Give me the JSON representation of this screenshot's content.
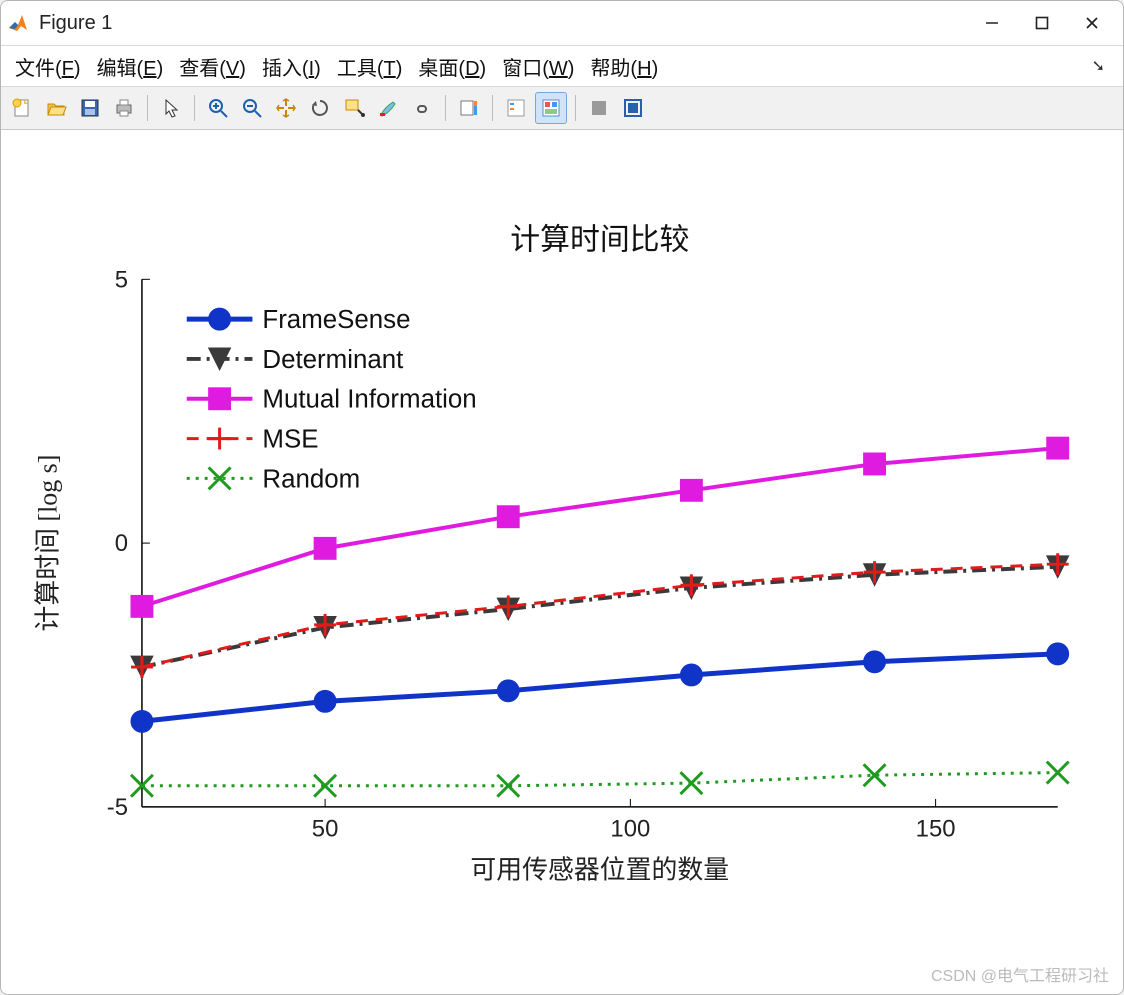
{
  "window": {
    "title": "Figure 1"
  },
  "menu": {
    "file": {
      "text": "文件(",
      "accel": "F",
      "tail": ")"
    },
    "edit": {
      "text": "编辑(",
      "accel": "E",
      "tail": ")"
    },
    "view": {
      "text": "查看(",
      "accel": "V",
      "tail": ")"
    },
    "insert": {
      "text": "插入(",
      "accel": "I",
      "tail": ")"
    },
    "tools": {
      "text": "工具(",
      "accel": "T",
      "tail": ")"
    },
    "desktop": {
      "text": "桌面(",
      "accel": "D",
      "tail": ")"
    },
    "windowm": {
      "text": "窗口(",
      "accel": "W",
      "tail": ")"
    },
    "help": {
      "text": "帮助(",
      "accel": "H",
      "tail": ")"
    }
  },
  "watermark": "CSDN @电气工程研习社",
  "chart_data": {
    "type": "line",
    "title": "计算时间比较",
    "xlabel": "可用传感器位置的数量",
    "ylabel": "计算时间 [log s]",
    "xlim": [
      20,
      170
    ],
    "ylim": [
      -5,
      5
    ],
    "xticks": [
      50,
      100,
      150
    ],
    "yticks": [
      -5,
      0,
      5
    ],
    "x": [
      20,
      50,
      80,
      110,
      140,
      170
    ],
    "series": [
      {
        "name": "FrameSense",
        "color": "#1134c8",
        "marker": "circle",
        "dash": "solid",
        "lw": 5,
        "values": [
          -3.38,
          -3.0,
          -2.8,
          -2.5,
          -2.25,
          -2.1
        ]
      },
      {
        "name": "Determinant",
        "color": "#3a3a3a",
        "marker": "triangle-down",
        "dash": "dashdot",
        "lw": 4,
        "values": [
          -2.35,
          -1.6,
          -1.25,
          -0.85,
          -0.6,
          -0.45
        ]
      },
      {
        "name": "Mutual Information",
        "color": "#e01be0",
        "marker": "square",
        "dash": "solid",
        "lw": 4,
        "values": [
          -1.2,
          -0.1,
          0.5,
          1.0,
          1.5,
          1.8
        ]
      },
      {
        "name": "MSE",
        "color": "#e21a1a",
        "marker": "plus",
        "dash": "dash",
        "lw": 3,
        "values": [
          -2.35,
          -1.55,
          -1.2,
          -0.8,
          -0.55,
          -0.4
        ]
      },
      {
        "name": "Random",
        "color": "#1f9b1f",
        "marker": "x",
        "dash": "dot",
        "lw": 3,
        "values": [
          -4.6,
          -4.6,
          -4.6,
          -4.55,
          -4.4,
          -4.35
        ]
      }
    ]
  }
}
